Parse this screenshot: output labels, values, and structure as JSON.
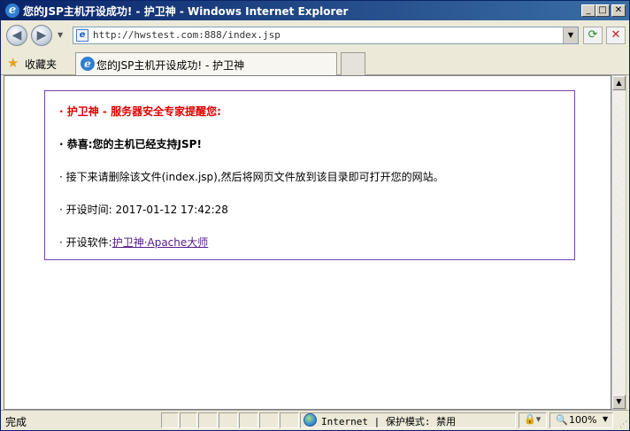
{
  "window": {
    "title": "您的JSP主机开设成功! - 护卫神 - Windows Internet Explorer",
    "minimize": "_",
    "maximize": "□",
    "close": "✕"
  },
  "nav": {
    "back_icon": "back-arrow-icon",
    "forward_icon": "forward-arrow-icon",
    "address": "http://hwstest.com:888/index.jsp",
    "refresh_icon": "refresh-icon",
    "stop_icon": "stop-icon"
  },
  "favorites": {
    "label": "收藏夹",
    "tab_title": "您的JSP主机开设成功! - 护卫神"
  },
  "page": {
    "line1": "· 护卫神 - 服务器安全专家提醒您:",
    "line2": "· 恭喜:您的主机已经支持JSP!",
    "line3": "· 接下来请删除该文件(index.jsp),然后将网页文件放到该目录即可打开您的网站。",
    "line4": "· 开设时间: 2017-01-12 17:42:28",
    "line5_prefix": "· 开设软件:",
    "line5_link": "护卫神·Apache大师"
  },
  "status": {
    "text": "完成",
    "zone": "Internet | 保护模式: 禁用",
    "zoom": "100%"
  },
  "colors": {
    "title_bar": "#0a246a",
    "alert_red": "#e00000",
    "box_border": "#7b3fb0",
    "link": "#551a8b"
  }
}
